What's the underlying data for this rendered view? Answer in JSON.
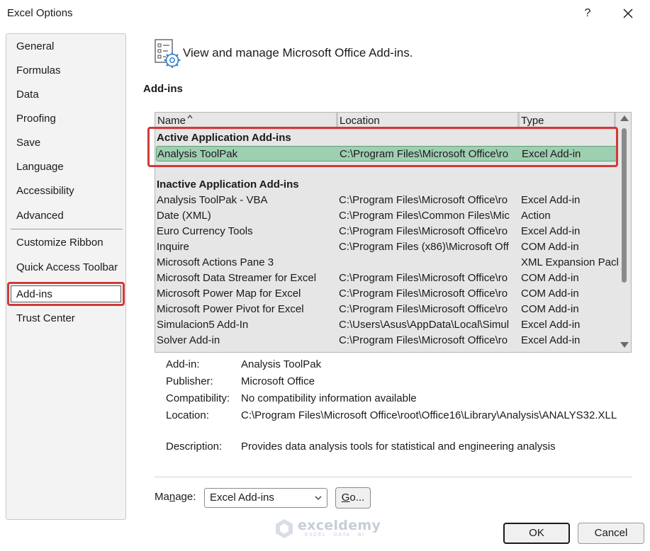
{
  "window": {
    "title": "Excel Options",
    "help_label": "?",
    "close_icon": "close-icon"
  },
  "sidebar": {
    "items": [
      {
        "label": "General"
      },
      {
        "label": "Formulas"
      },
      {
        "label": "Data"
      },
      {
        "label": "Proofing"
      },
      {
        "label": "Save"
      },
      {
        "label": "Language"
      },
      {
        "label": "Accessibility"
      },
      {
        "label": "Advanced"
      },
      {
        "label": "Customize Ribbon"
      },
      {
        "label": "Quick Access Toolbar"
      },
      {
        "label": "Add-ins",
        "selected": true
      },
      {
        "label": "Trust Center"
      }
    ]
  },
  "header": {
    "icon": "add-ins-settings-icon",
    "text": "View and manage Microsoft Office Add-ins."
  },
  "addins": {
    "section_title": "Add-ins",
    "columns": {
      "name": "Name",
      "location": "Location",
      "type": "Type"
    },
    "sort_indicator": "ascending",
    "active_group": {
      "title": "Active Application Add-ins",
      "rows": [
        {
          "name": "Analysis ToolPak",
          "location": "C:\\Program Files\\Microsoft Office\\ro",
          "type": "Excel Add-in",
          "selected": true
        }
      ]
    },
    "inactive_group": {
      "title": "Inactive Application Add-ins",
      "rows": [
        {
          "name": "Analysis ToolPak - VBA",
          "location": "C:\\Program Files\\Microsoft Office\\ro",
          "type": "Excel Add-in"
        },
        {
          "name": "Date (XML)",
          "location": "C:\\Program Files\\Common Files\\Mic",
          "type": "Action"
        },
        {
          "name": "Euro Currency Tools",
          "location": "C:\\Program Files\\Microsoft Office\\ro",
          "type": "Excel Add-in"
        },
        {
          "name": "Inquire",
          "location": "C:\\Program Files (x86)\\Microsoft Off",
          "type": "COM Add-in"
        },
        {
          "name": "Microsoft Actions Pane 3",
          "location": "",
          "type": "XML Expansion Pack"
        },
        {
          "name": "Microsoft Data Streamer for Excel",
          "location": "C:\\Program Files\\Microsoft Office\\ro",
          "type": "COM Add-in"
        },
        {
          "name": "Microsoft Power Map for Excel",
          "location": "C:\\Program Files\\Microsoft Office\\ro",
          "type": "COM Add-in"
        },
        {
          "name": "Microsoft Power Pivot for Excel",
          "location": "C:\\Program Files\\Microsoft Office\\ro",
          "type": "COM Add-in"
        },
        {
          "name": "Simulacion5 Add-In",
          "location": "C:\\Users\\Asus\\AppData\\Local\\Simul",
          "type": "Excel Add-in"
        },
        {
          "name": "Solver Add-in",
          "location": "C:\\Program Files\\Microsoft Office\\ro",
          "type": "Excel Add-in"
        }
      ]
    }
  },
  "details": {
    "addin_label": "Add-in:",
    "addin_value": "Analysis ToolPak",
    "publisher_label": "Publisher:",
    "publisher_value": "Microsoft Office",
    "compat_label": "Compatibility:",
    "compat_value": "No compatibility information available",
    "location_label": "Location:",
    "location_value": "C:\\Program Files\\Microsoft Office\\root\\Office16\\Library\\Analysis\\ANALYS32.XLL",
    "description_label": "Description:",
    "description_value": "Provides data analysis tools for statistical and engineering analysis"
  },
  "manage": {
    "label_prefix": "Ma",
    "label_accel": "n",
    "label_suffix": "age:",
    "selected": "Excel Add-ins",
    "go_accel": "G",
    "go_suffix": "o..."
  },
  "buttons": {
    "ok": "OK",
    "cancel": "Cancel"
  },
  "watermark": {
    "name": "exceldemy",
    "tagline": "EXCEL · DATA · BI"
  },
  "colors": {
    "highlight_red": "#d03a3a",
    "selected_row": "#9fcfb1",
    "list_bg": "#e6e6e6",
    "sidebar_bg": "#f3f3f3"
  }
}
